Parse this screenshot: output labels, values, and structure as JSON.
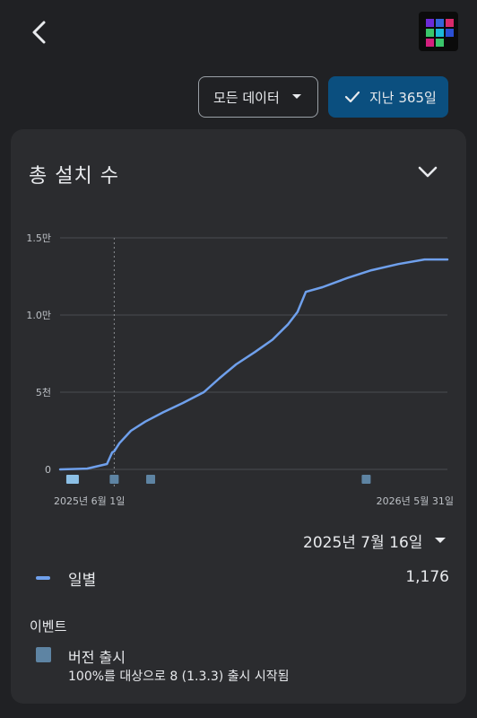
{
  "top_bar": {
    "back_icon": "chevron-left-icon",
    "app_icon": "app-logo-icon"
  },
  "filters": {
    "data_filter_label": "모든 데이터",
    "range_label": "지난 365일",
    "range_selected": true
  },
  "card": {
    "title": "총 설치 수",
    "toggle_icon": "chevron-down-icon",
    "date_label": "2025년 7월 16일"
  },
  "legend": {
    "label": "일별",
    "value": "1,176"
  },
  "events": {
    "title": "이벤트",
    "items": [
      {
        "name": "버전 출시",
        "description": "100%를 대상으로 8 (1.3.3) 출시 시작됨"
      }
    ]
  },
  "colors": {
    "background": "#202124",
    "card": "#2b2c2f",
    "accent": "#0b4f7f",
    "line": "#6fa0ec",
    "event_marker": "#5e84a3",
    "event_marker_highlight": "#8cc0e6"
  },
  "chart_data": {
    "type": "line",
    "title": "총 설치 수",
    "xlabel": "",
    "ylabel": "",
    "x_tick_labels": [
      "2025년 6월 1일",
      "2026년 5월 31일"
    ],
    "y_ticks": [
      {
        "value": 0,
        "label": "0"
      },
      {
        "value": 5000,
        "label": "5천"
      },
      {
        "value": 10000,
        "label": "1.0만"
      },
      {
        "value": 15000,
        "label": "1.5만"
      }
    ],
    "ylim": [
      0,
      15000
    ],
    "xlim": [
      "2025-05-25",
      "2026-06-01"
    ],
    "grid": true,
    "selected_date": "2025-07-16",
    "series": [
      {
        "name": "일별",
        "points": [
          [
            "2025-05-25",
            0
          ],
          [
            "2025-06-20",
            50
          ],
          [
            "2025-07-09",
            350
          ],
          [
            "2025-07-14",
            1100
          ],
          [
            "2025-07-16",
            1176
          ],
          [
            "2025-07-21",
            1700
          ],
          [
            "2025-08-01",
            2500
          ],
          [
            "2025-08-15",
            3100
          ],
          [
            "2025-09-01",
            3700
          ],
          [
            "2025-09-20",
            4300
          ],
          [
            "2025-10-10",
            5000
          ],
          [
            "2025-10-25",
            5900
          ],
          [
            "2025-11-10",
            6800
          ],
          [
            "2025-11-28",
            7600
          ],
          [
            "2025-12-15",
            8400
          ],
          [
            "2025-12-30",
            9400
          ],
          [
            "2026-01-08",
            10200
          ],
          [
            "2026-01-16",
            11500
          ],
          [
            "2026-02-01",
            11800
          ],
          [
            "2026-02-25",
            12400
          ],
          [
            "2026-03-20",
            12900
          ],
          [
            "2026-04-15",
            13300
          ],
          [
            "2026-05-10",
            13600
          ],
          [
            "2026-05-20",
            13600
          ],
          [
            "2026-06-01",
            13600
          ]
        ]
      }
    ],
    "event_markers": [
      {
        "date": "2025-06-06",
        "highlight": true
      },
      {
        "date": "2025-07-16",
        "highlight": false
      },
      {
        "date": "2025-08-20",
        "highlight": false
      },
      {
        "date": "2026-03-15",
        "highlight": false
      }
    ]
  }
}
